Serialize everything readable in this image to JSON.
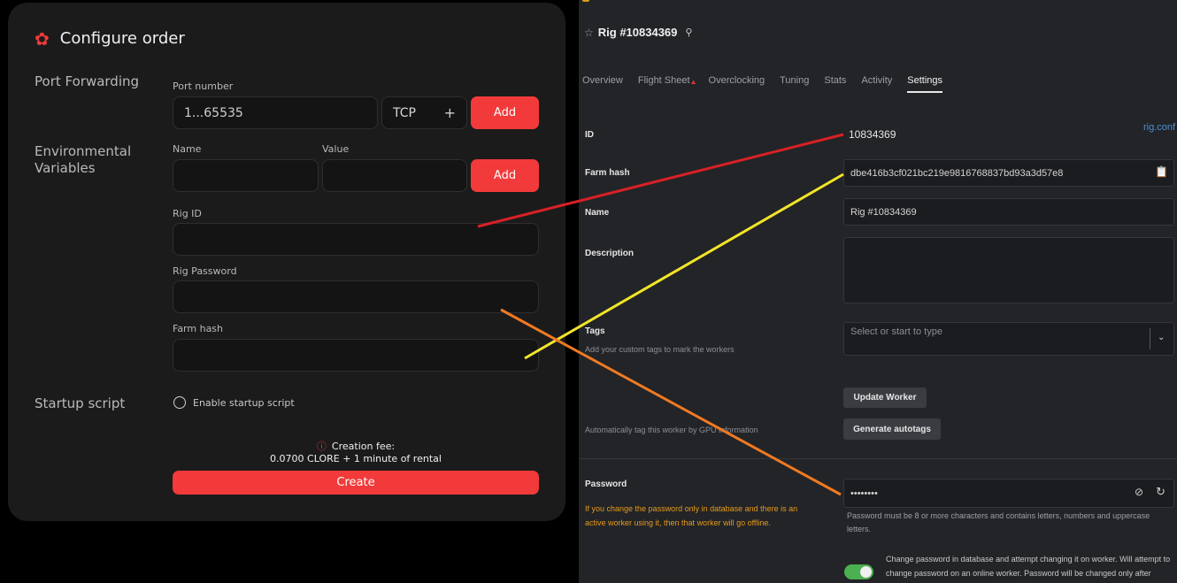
{
  "left": {
    "title": "Configure order",
    "sections": {
      "port_forwarding": "Port Forwarding",
      "env_vars": "Environmental Variables",
      "startup": "Startup script"
    },
    "port": {
      "label": "Port number",
      "placeholder": "1...65535",
      "protocol": "TCP",
      "add": "Add"
    },
    "env": {
      "name_label": "Name",
      "value_label": "Value",
      "add": "Add"
    },
    "rig_id_label": "Rig ID",
    "rig_password_label": "Rig Password",
    "farm_hash_label": "Farm hash",
    "startup_checkbox": "Enable startup script",
    "fee_line1": "Creation fee:",
    "fee_line2": "0.0700 CLORE + 1 minute of rental",
    "create": "Create"
  },
  "right": {
    "title": "Rig #10834369",
    "tabs": [
      "Overview",
      "Flight Sheet",
      "Overclocking",
      "Tuning",
      "Stats",
      "Activity",
      "Settings"
    ],
    "active_tab": "Settings",
    "id_label": "ID",
    "id_value": "10834369",
    "rig_conf": "rig.conf",
    "farm_hash_label": "Farm hash",
    "farm_hash_value": "dbe416b3cf021bc219e9816768837bd93a3d57e8",
    "name_label": "Name",
    "name_value": "Rig #10834369",
    "description_label": "Description",
    "tags_label": "Tags",
    "tags_sub": "Add your custom tags to mark the workers",
    "tags_placeholder": "Select or start to type",
    "update_worker": "Update Worker",
    "autotag_sub": "Automatically tag this worker by GPU information",
    "generate_autotags": "Generate autotags",
    "password_label": "Password",
    "password_value": "••••••••",
    "password_warning": "If you change the password only in database and there is an active worker using it, then that worker will go offline.",
    "password_help": "Password must be 8 or more characters and contains letters, numbers and uppercase letters.",
    "toggle_text": "Change password in database and attempt changing it on worker. Will attempt to change password on an online worker. Password will be changed only after"
  },
  "colors": {
    "accent_red": "#f23a3a",
    "line_red": "#d92027",
    "line_yellow": "#f2e529",
    "line_orange": "#f07a22",
    "toggle_green": "#4caf50"
  }
}
